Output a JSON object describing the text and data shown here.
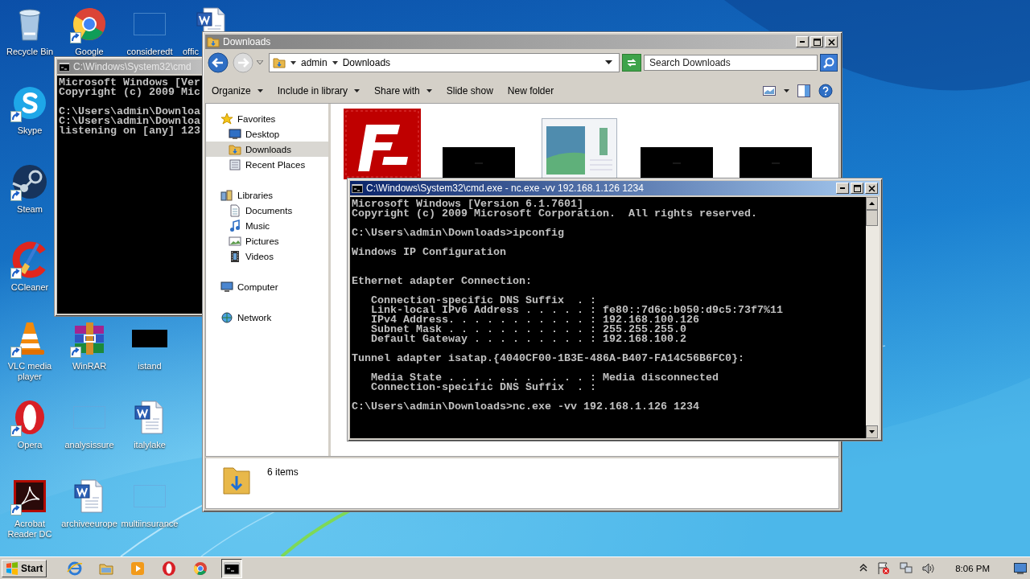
{
  "desktop_icons": [
    {
      "label": "Recycle Bin",
      "shortcut": false
    },
    {
      "label": "Google",
      "shortcut": true
    },
    {
      "label": "consideredt",
      "shortcut": false
    },
    {
      "label": "offic",
      "shortcut": false
    },
    {
      "label": "Skype",
      "shortcut": true
    },
    {
      "label": "Steam",
      "shortcut": true
    },
    {
      "label": "CCleaner",
      "shortcut": true
    },
    {
      "label": "VLC media player",
      "shortcut": true
    },
    {
      "label": "WinRAR",
      "shortcut": true
    },
    {
      "label": "istand",
      "shortcut": false
    },
    {
      "label": "Opera",
      "shortcut": true
    },
    {
      "label": "analysissure",
      "shortcut": false
    },
    {
      "label": "italylake",
      "shortcut": false
    },
    {
      "label": "Acrobat Reader DC",
      "shortcut": true
    },
    {
      "label": "archiveeurope",
      "shortcut": false
    },
    {
      "label": "multiinsurance",
      "shortcut": false
    }
  ],
  "back_console": {
    "title": "C:\\Windows\\System32\\cmd",
    "active": false,
    "text": "Microsoft Windows [Ver\nCopyright (c) 2009 Mic\n\nC:\\Users\\admin\\Downloa\nC:\\Users\\admin\\Downloa\nlistening on [any] 123"
  },
  "explorer": {
    "title": "Downloads",
    "active": false,
    "breadcrumb": [
      "admin",
      "Downloads"
    ],
    "search": {
      "placeholder": "Search Downloads"
    },
    "toolbar": [
      {
        "label": "Organize",
        "dropdown": true
      },
      {
        "label": "Include in library",
        "dropdown": true
      },
      {
        "label": "Share with",
        "dropdown": true
      },
      {
        "label": "Slide show",
        "dropdown": false
      },
      {
        "label": "New folder",
        "dropdown": false
      }
    ],
    "nav": [
      {
        "label": "Favorites",
        "selected": false,
        "children": [
          {
            "label": "Desktop",
            "selected": false
          },
          {
            "label": "Downloads",
            "selected": true
          },
          {
            "label": "Recent Places",
            "selected": false
          }
        ]
      },
      {
        "label": "Libraries",
        "selected": false,
        "children": [
          {
            "label": "Documents",
            "selected": false
          },
          {
            "label": "Music",
            "selected": false
          },
          {
            "label": "Pictures",
            "selected": false
          },
          {
            "label": "Videos",
            "selected": false
          }
        ]
      },
      {
        "label": "Computer",
        "selected": false
      },
      {
        "label": "Network",
        "selected": false
      }
    ],
    "files": [
      {
        "kind": "app"
      },
      {
        "kind": "dark"
      },
      {
        "kind": "window"
      },
      {
        "kind": "dark"
      },
      {
        "kind": "dark"
      }
    ],
    "status": "6 items"
  },
  "console": {
    "title": "C:\\Windows\\System32\\cmd.exe - nc.exe -vv 192.168.1.126 1234",
    "active": true,
    "text": "Microsoft Windows [Version 6.1.7601]\nCopyright (c) 2009 Microsoft Corporation.  All rights reserved.\n\nC:\\Users\\admin\\Downloads>ipconfig\n\nWindows IP Configuration\n\n\nEthernet adapter Connection:\n\n   Connection-specific DNS Suffix  . :\n   Link-local IPv6 Address . . . . . : fe80::7d6c:b050:d9c5:73f7%11\n   IPv4 Address. . . . . . . . . . . : 192.168.100.126\n   Subnet Mask . . . . . . . . . . . : 255.255.255.0\n   Default Gateway . . . . . . . . . : 192.168.100.2\n\nTunnel adapter isatap.{4040CF00-1B3E-486A-B407-FA14C56B6FC0}:\n\n   Media State . . . . . . . . . . . : Media disconnected\n   Connection-specific DNS Suffix  . :\n\nC:\\Users\\admin\\Downloads>nc.exe -vv 192.168.1.126 1234"
  },
  "taskbar": {
    "start": "Start",
    "apps": [
      {
        "active": false
      },
      {
        "active": false
      },
      {
        "active": false
      },
      {
        "active": false
      },
      {
        "active": false
      },
      {
        "active": true
      }
    ],
    "time": "8:06 PM"
  }
}
